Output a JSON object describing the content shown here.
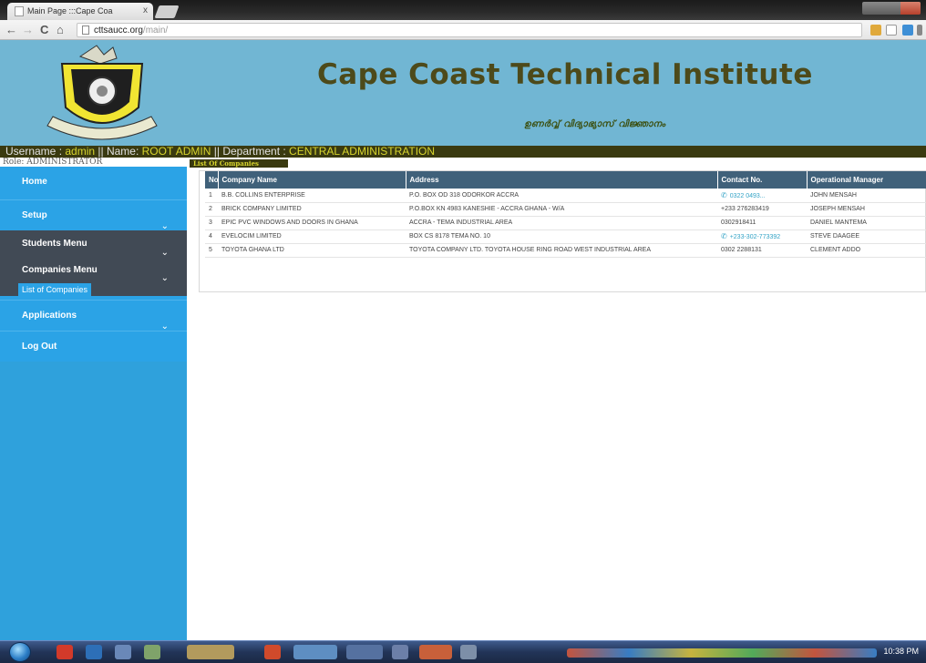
{
  "browser": {
    "tab_title": "Main Page :::Cape Coa",
    "tab_close": "x",
    "url_host": "cttsaucc.org",
    "url_path": "/main/",
    "back": "←",
    "forward": "→",
    "reload": "C",
    "home": "⌂"
  },
  "header": {
    "title": "Cape Coast Technical Institute",
    "motto": "ഉണർവ്വ് വിദ്യാഭ്യാസ് വിജ്ഞാനം"
  },
  "userbar": {
    "username_label": "Username : ",
    "username": "admin",
    "sep1": " || ",
    "name_label": "Name: ",
    "name": "ROOT  ADMIN",
    "sep2": " || ",
    "dept_label": "Department : ",
    "department": "CENTRAL ADMINISTRATION"
  },
  "role_text": "Role: ADMINISTRATOR",
  "sidebar": {
    "home": "Home",
    "setup": "Setup",
    "students_menu": "Students Menu",
    "companies_menu": "Companies Menu",
    "list_of_companies": "List of Companies",
    "applications": "Applications",
    "logout": "Log Out",
    "caret": "⌄"
  },
  "main": {
    "panel_title": "List Of Companies",
    "columns": [
      "No",
      "Company Name",
      "Address",
      "Contact No.",
      "Operational Manager"
    ],
    "rows": [
      {
        "no": "1",
        "name": "B.B. COLLINS ENTERPRISE",
        "address": "P.O. BOX OD 318 ODORKOR ACCRA",
        "contact": "0322 0493...",
        "contact_link": true,
        "manager": "JOHN MENSAH"
      },
      {
        "no": "2",
        "name": "BRICK COMPANY LIMITED",
        "address": "P.O.BOX KN 4983 KANESHIE - ACCRA GHANA - W/A",
        "contact": "+233 276283419",
        "contact_link": false,
        "manager": "JOSEPH MENSAH"
      },
      {
        "no": "3",
        "name": "EPIC PVC WINDOWS AND DOORS IN GHANA",
        "address": "ACCRA - TEMA INDUSTRIAL AREA",
        "contact": "0302918411",
        "contact_link": false,
        "manager": "DANIEL MANTEMA"
      },
      {
        "no": "4",
        "name": "EVELOCIM LIMITED",
        "address": "BOX CS 8178 TEMA NO. 10",
        "contact": "+233-302-773392",
        "contact_link": true,
        "manager": "STEVE DAAGEE"
      },
      {
        "no": "5",
        "name": "TOYOTA GHANA LTD",
        "address": "TOYOTA COMPANY LTD. TOYOTA HOUSE RING ROAD WEST INDUSTRIAL AREA",
        "contact": "0302 2288131",
        "contact_link": false,
        "manager": "CLEMENT ADDO"
      }
    ]
  },
  "taskbar": {
    "clock": "10:38 PM"
  },
  "colors": {
    "header_bg": "#71b6d3",
    "sidebar_blue": "#2ba3e6",
    "sidebar_dark": "#414a55",
    "userbar_bg": "#3a3a10",
    "title_olive": "#4d4a1a",
    "table_header": "#40617a"
  },
  "icons": [
    "crest-logo",
    "phone-icon",
    "chevron-down-icon",
    "start-orb-icon"
  ]
}
